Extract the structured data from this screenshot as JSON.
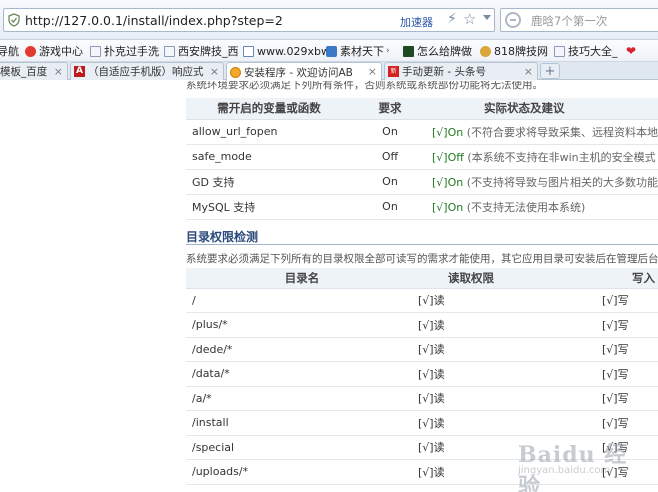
{
  "browser": {
    "url": "http://127.0.0.1/install/index.php?step=2",
    "accelerator": "加速器",
    "search_placeholder": "鹿晗7个第一次",
    "bookmarks": [
      {
        "label": "导航",
        "icon": "page-icon"
      },
      {
        "label": "游戏中心",
        "icon": "game-icon"
      },
      {
        "label": "扑克过手洗",
        "icon": "page-icon"
      },
      {
        "label": "西安牌技_西",
        "icon": "page-icon"
      },
      {
        "label": "www.029xbw",
        "icon": "page-icon"
      },
      {
        "label": "素材天下",
        "icon": "page-icon"
      },
      {
        "label": "怎么给牌做",
        "icon": "page-icon"
      },
      {
        "label": "818牌技网",
        "icon": "page-icon"
      },
      {
        "label": "技巧大全_",
        "icon": "page-icon"
      }
    ],
    "tabs": [
      {
        "label": "模板_百度",
        "active": false
      },
      {
        "label": "（自适应手机版）响应式",
        "active": false
      },
      {
        "label": "安装程序 - 欢迎访问AB",
        "active": true
      },
      {
        "label": "手动更新 - 头条号",
        "active": false
      }
    ],
    "new_tab_label": "+"
  },
  "page": {
    "intro_top": "系统环境要求必须满足下列所有条件，否则系统或系统部份功能将无法使用。",
    "env_table": {
      "headers": [
        "需开启的变量或函数",
        "要求",
        "实际状态及建议"
      ],
      "rows": [
        {
          "name": "allow_url_fopen",
          "req": "On",
          "status": "[√]On",
          "note": "(不符合要求将导致采集、远程资料本地"
        },
        {
          "name": "safe_mode",
          "req": "Off",
          "status": "[√]Off",
          "note": "(本系统不支持在非win主机的安全模式"
        },
        {
          "name": "GD 支持",
          "req": "On",
          "status": "[√]On",
          "note": "(不支持将导致与图片相关的大多数功能"
        },
        {
          "name": "MySQL 支持",
          "req": "On",
          "status": "[√]On",
          "note": "(不支持无法使用本系统)"
        }
      ]
    },
    "perm_section_title": "目录权限检测",
    "perm_intro": "系统要求必须满足下列所有的目录权限全部可读写的需求才能使用，其它应用目录可安装后在管理后台检",
    "perm_table": {
      "headers": [
        "目录名",
        "读取权限",
        "写入"
      ],
      "rows": [
        {
          "dir": "/",
          "read": "[√]读",
          "write": "[√]写"
        },
        {
          "dir": "/plus/*",
          "read": "[√]读",
          "write": "[√]写"
        },
        {
          "dir": "/dede/*",
          "read": "[√]读",
          "write": "[√]写"
        },
        {
          "dir": "/data/*",
          "read": "[√]读",
          "write": "[√]写"
        },
        {
          "dir": "/a/*",
          "read": "[√]读",
          "write": "[√]写"
        },
        {
          "dir": "/install",
          "read": "[√]读",
          "write": "[√]写"
        },
        {
          "dir": "/special",
          "read": "[√]读",
          "write": "[√]写"
        },
        {
          "dir": "/uploads/*",
          "read": "[√]读",
          "write": "[√]写"
        }
      ]
    },
    "watermark": {
      "text": "Baidu 经验",
      "sub": "jingyan.baidu.com"
    }
  }
}
